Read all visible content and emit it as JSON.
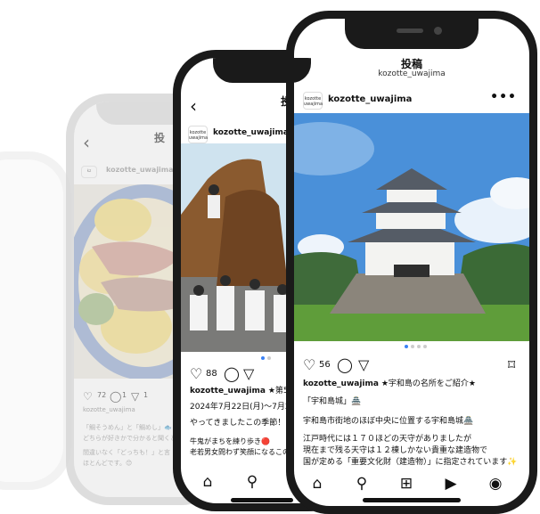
{
  "phones": {
    "front": {
      "title": "投稿",
      "subtitle": "kozotte_uwajima",
      "avatar_text": "kozotte uwajima",
      "username": "kozotte_uwajima",
      "more": "•••",
      "likes": "56",
      "caption_user": "kozotte_uwajima",
      "caption_lines": [
        "★宇和島の名所をご紹介★",
        "「宇和島城」🏯",
        "宇和島市街地のほぼ中央に位置する宇和島城🏯",
        "江戸時代には１７０ほどの天守がありましたが",
        "現在まで残る天守は１２棟しかない貴重な建造物で",
        "国が定める「重要文化財（建造物）」に指定されています✨"
      ],
      "icons": {
        "back": "chevron-left",
        "like": "heart",
        "comment": "comment",
        "share": "send",
        "save": "bookmark"
      },
      "nav": [
        "home-icon",
        "search-icon",
        "add-post-icon",
        "reels-icon",
        "profile-icon"
      ]
    },
    "middle": {
      "username": "kozotte_uwajima",
      "title_fragment": "投",
      "likes": "88",
      "caption_user": "kozotte_uwajima",
      "caption_line1": "★第58回う",
      "date_line": "2024年7月22日(月)〜7月24日",
      "line2": "やってきましたこの季節！！",
      "line3": "牛鬼がまちを練り歩き🔴",
      "line4": "老若男女問わず笑顔になるこの祭"
    },
    "back2": {
      "username": "kozotte_uwajima",
      "title_fragment": "投",
      "comments": "72",
      "comments2": "1",
      "shares": "1",
      "caption_user": "kozotte_uwajima",
      "line1": "「鯛そうめん」と「鯛めし」🐟",
      "line2": "どちらが好きかで分かると聞くと、",
      "line3": "間違いなく「どっちも！」と言",
      "line4": "ほとんどです。😊"
    }
  },
  "colors": {
    "frame": "#1a1a1a",
    "sky": "#4a90d9",
    "grass": "#5f9d3a",
    "active_dot": "#3b82f6"
  }
}
